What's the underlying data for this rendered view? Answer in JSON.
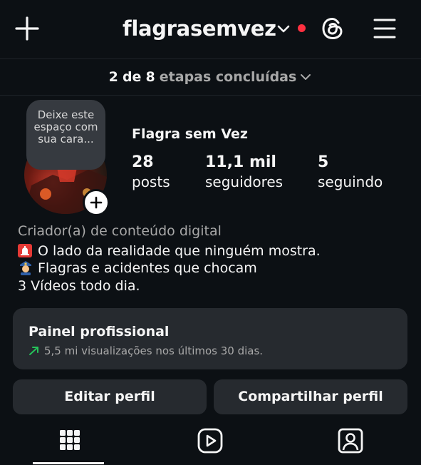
{
  "header": {
    "username": "flagrasemvez"
  },
  "steps": {
    "done": "2",
    "of": "de",
    "total": "8",
    "label": "etapas concluídas"
  },
  "avatar": {
    "note_text": "Deixe este espaço com sua cara..."
  },
  "profile": {
    "display_name": "Flagra sem Vez",
    "stats": [
      {
        "value": "28",
        "label": "posts"
      },
      {
        "value": "11,1 mil",
        "label": "seguidores"
      },
      {
        "value": "5",
        "label": "seguindo"
      }
    ]
  },
  "bio": {
    "category": "Criador(a) de conteúdo digital",
    "line1": "O lado da realidade que ninguém mostra.",
    "line2": "Flagras e acidentes que chocam",
    "line3": "3 Vídeos todo dia."
  },
  "panel": {
    "title": "Painel profissional",
    "subtitle": "5,5 mi visualizações nos últimos 30 dias.",
    "trend_color": "#25c35a"
  },
  "buttons": {
    "edit": "Editar perfil",
    "share": "Compartilhar perfil"
  },
  "colors": {
    "background": "#0c1014",
    "surface": "#262a2f",
    "notification_dot": "#ff3040",
    "muted_text": "#a8a8a8"
  }
}
